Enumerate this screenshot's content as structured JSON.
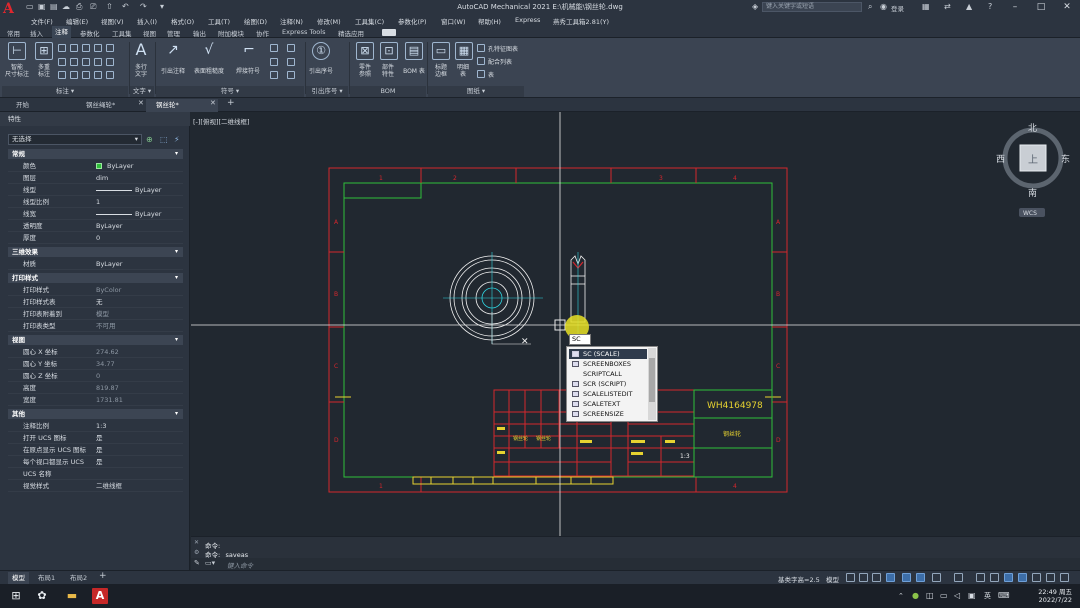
{
  "app": {
    "title": "AutoCAD Mechanical 2021    E:\\机械能\\钢丝轮.dwg",
    "search_placeholder": "键入关键字或短语",
    "login": "登录"
  },
  "menus": [
    "文件(F)",
    "编辑(E)",
    "视图(V)",
    "插入(I)",
    "格式(O)",
    "工具(T)",
    "绘图(D)",
    "注释(N)",
    "修改(M)",
    "工具集(C)",
    "参数化(P)",
    "窗口(W)",
    "帮助(H)",
    "Express",
    "燕秀工具箱2.81(Y)"
  ],
  "ribbon_tabs": [
    "常用",
    "插入",
    "注释",
    "参数化",
    "工具集",
    "视图",
    "管理",
    "输出",
    "附加模块",
    "协作",
    "Express Tools",
    "精选应用"
  ],
  "ribbon": {
    "dim_smart": "智能\n尺寸标注",
    "dim_multi": "多重\n标注",
    "mtext": "多行\n文字",
    "leader": "引出注释",
    "surface": "表面粗糙度",
    "weld": "焊接符号",
    "balloon": "引出序号",
    "part_ref": "零件\n参照",
    "part_props": "部件\n特性",
    "bom_table": "BOM 表",
    "title_border": "标题\n边框",
    "detail": "明细\n表",
    "hole_chart": "孔特征图表",
    "fit_list": "配合列表",
    "table": "表",
    "groups": [
      "标注",
      "文字",
      "符号",
      "引出序号",
      "BOM",
      "图纸"
    ]
  },
  "doc_tabs": [
    "开始",
    "钢丝绳轮*",
    "钢丝轮*"
  ],
  "properties": {
    "header": "特性",
    "selection": "无选择",
    "sections": {
      "general": "常规",
      "3d": "三维效果",
      "plot": "打印样式",
      "view": "视图",
      "misc": "其他"
    },
    "general": [
      {
        "k": "颜色",
        "v": "ByLayer"
      },
      {
        "k": "图层",
        "v": "dim"
      },
      {
        "k": "线型",
        "v": "ByLayer"
      },
      {
        "k": "线型比例",
        "v": "1"
      },
      {
        "k": "线宽",
        "v": "ByLayer"
      },
      {
        "k": "透明度",
        "v": "ByLayer"
      },
      {
        "k": "厚度",
        "v": "0"
      }
    ],
    "three_d": [
      {
        "k": "材质",
        "v": "ByLayer"
      }
    ],
    "plot": [
      {
        "k": "打印样式",
        "v": "ByColor"
      },
      {
        "k": "打印样式表",
        "v": "无"
      },
      {
        "k": "打印表附着到",
        "v": "模型"
      },
      {
        "k": "打印表类型",
        "v": "不可用"
      }
    ],
    "view": [
      {
        "k": "圆心 X 坐标",
        "v": "274.62"
      },
      {
        "k": "圆心 Y 坐标",
        "v": "34.77"
      },
      {
        "k": "圆心 Z 坐标",
        "v": "0"
      },
      {
        "k": "高度",
        "v": "819.87"
      },
      {
        "k": "宽度",
        "v": "1731.81"
      }
    ],
    "misc": [
      {
        "k": "注释比例",
        "v": "1:3"
      },
      {
        "k": "打开 UCS 图标",
        "v": "是"
      },
      {
        "k": "在原点显示 UCS 图标",
        "v": "是"
      },
      {
        "k": "每个视口都显示 UCS",
        "v": "是"
      },
      {
        "k": "UCS 名称",
        "v": ""
      },
      {
        "k": "视觉样式",
        "v": "二维线框"
      }
    ]
  },
  "canvas": {
    "view_label": "[-][俯视][二维线框]",
    "viewcube": {
      "north": "北",
      "south": "南",
      "east": "东",
      "west": "西",
      "top": "上",
      "wcs": "WCS"
    },
    "drawing_number": "WH4164978",
    "part_name": "钢丝轮",
    "scale": "1:3",
    "grid_cols_top": [
      "1",
      "2",
      "3",
      "4"
    ],
    "grid_rows": [
      "A",
      "B",
      "C",
      "D",
      "E",
      "F"
    ],
    "title_small": [
      "钢丝轮",
      "钢丝轮"
    ],
    "title_mark": "件"
  },
  "autocomplete": {
    "typed": "SC",
    "items": [
      "SC (SCALE)",
      "SCREENBOXES",
      "SCRIPTCALL",
      "SCR (SCRIPT)",
      "SCALELISTEDIT",
      "SCALETEXT",
      "SCREENSIZE"
    ],
    "selected_index": 0
  },
  "command": {
    "history": [
      "命令:",
      "命令: _saveas"
    ],
    "placeholder": "键入命令"
  },
  "layout_tabs": [
    "模型",
    "布局1",
    "布局2"
  ],
  "status": {
    "annoscale": "基类字高=2.5",
    "model": "模型"
  },
  "taskbar": {
    "time": "22:49 周五",
    "date": "2022/7/22",
    "ime": "英"
  }
}
